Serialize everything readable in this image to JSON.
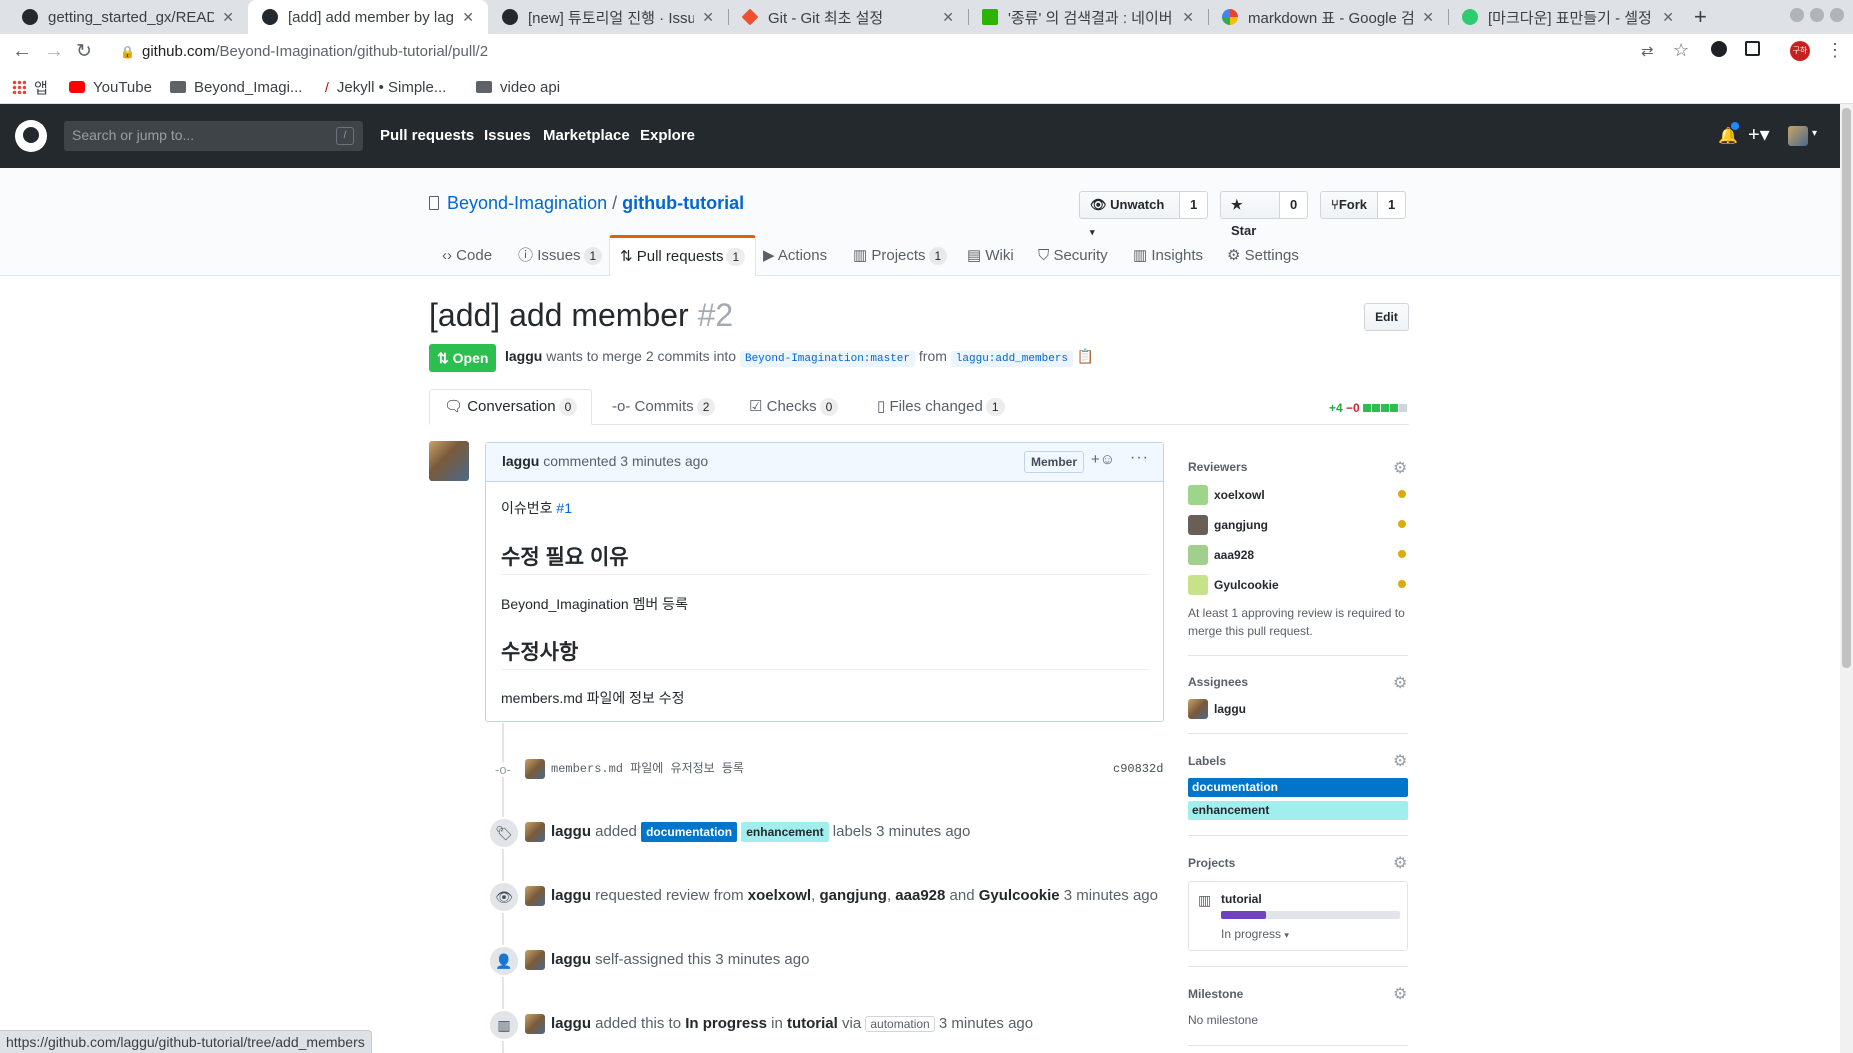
{
  "browser": {
    "tabs": [
      {
        "title": "getting_started_gx/READ",
        "icon": "github-icon",
        "active": false
      },
      {
        "title": "[add] add member by lagg",
        "icon": "github-icon",
        "active": true
      },
      {
        "title": "[new] 튜토리얼 진행 · Issue",
        "icon": "github-icon",
        "active": false
      },
      {
        "title": "Git - Git 최초 설정",
        "icon": "git-icon",
        "active": false
      },
      {
        "title": "'종류' 의 검색결과 : 네이버",
        "icon": "naver-icon",
        "active": false
      },
      {
        "title": "markdown 표 - Google 검",
        "icon": "google-icon",
        "active": false
      },
      {
        "title": "[마크다운] 표만들기 - 셀정",
        "icon": "site-icon",
        "active": false
      }
    ],
    "url_host": "github.com",
    "url_path": "/Beyond-Imagination/github-tutorial/pull/2",
    "bookmarks": [
      {
        "label": "앱",
        "icon": "apps-grid-icon"
      },
      {
        "label": "YouTube",
        "icon": "youtube-icon"
      },
      {
        "label": "Beyond_Imagi...",
        "icon": "folder-icon"
      },
      {
        "label": "Jekyll • Simple...",
        "icon": "jekyll-icon"
      },
      {
        "label": "video api",
        "icon": "folder-icon"
      }
    ],
    "profile_badge": "구하",
    "status_url": "https://github.com/laggu/github-tutorial/tree/add_members"
  },
  "header": {
    "search_placeholder": "Search or jump to...",
    "slash_key": "/",
    "nav": [
      "Pull requests",
      "Issues",
      "Marketplace",
      "Explore"
    ]
  },
  "repo": {
    "owner": "Beyond-Imagination",
    "separator": "/",
    "name": "github-tutorial",
    "unwatch_label": "Unwatch",
    "unwatch_count": "1",
    "star_label": "Star",
    "star_count": "0",
    "fork_label": "Fork",
    "fork_count": "1",
    "tabs": [
      {
        "label": "Code",
        "count": ""
      },
      {
        "label": "Issues",
        "count": "1"
      },
      {
        "label": "Pull requests",
        "count": "1"
      },
      {
        "label": "Actions",
        "count": ""
      },
      {
        "label": "Projects",
        "count": "1"
      },
      {
        "label": "Wiki",
        "count": ""
      },
      {
        "label": "Security",
        "count": ""
      },
      {
        "label": "Insights",
        "count": ""
      },
      {
        "label": "Settings",
        "count": ""
      }
    ]
  },
  "pr": {
    "title": "[add] add member",
    "number": "#2",
    "edit_label": "Edit",
    "state": "Open",
    "author": "laggu",
    "merge_text": "wants to merge 2 commits into",
    "base_branch": "Beyond-Imagination:master",
    "from_text": "from",
    "head_branch": "laggu:add_members",
    "tabs": [
      {
        "label": "Conversation",
        "count": "0"
      },
      {
        "label": "Commits",
        "count": "2"
      },
      {
        "label": "Checks",
        "count": "0"
      },
      {
        "label": "Files changed",
        "count": "1"
      }
    ],
    "diff_add": "+4",
    "diff_del": "−0"
  },
  "comment": {
    "author": "laggu",
    "meta": "commented 3 minutes ago",
    "role": "Member",
    "issue_prefix": "이슈번호",
    "issue_ref": "#1",
    "h1": "수정 필요 이유",
    "p1": "Beyond_Imagination 멤버 등록",
    "h2": "수정사항",
    "p2": "members.md 파일에 정보 수정"
  },
  "timeline": {
    "commit_msg": "members.md 파일에 유저정보 등록",
    "commit_sha": "c90832d",
    "labels_event": {
      "user": "laggu",
      "verb": "added",
      "label1": "documentation",
      "label2": "enhancement",
      "suffix": "labels 3 minutes ago"
    },
    "review_event": {
      "user": "laggu",
      "verb": "requested review from",
      "r1": "xoelxowl",
      "sep1": ",",
      "r2": "gangjung",
      "sep2": ",",
      "r3": "aaa928",
      "and": "and",
      "r4": "Gyulcookie",
      "time": "3 minutes ago"
    },
    "assign_event": {
      "user": "laggu",
      "text": "self-assigned this 3 minutes ago"
    },
    "project_event": {
      "user": "laggu",
      "verb": "added this to",
      "column": "In progress",
      "in": "in",
      "project": "tutorial",
      "via": "via",
      "automation": "automation",
      "time": "3 minutes ago"
    }
  },
  "sidebar": {
    "reviewers_title": "Reviewers",
    "reviewers": [
      "xoelxowl",
      "gangjung",
      "aaa928",
      "Gyulcookie"
    ],
    "reviewers_note": "At least 1 approving review is required to merge this pull request.",
    "assignees_title": "Assignees",
    "assignee": "laggu",
    "labels_title": "Labels",
    "labels": [
      {
        "name": "documentation",
        "color": "#0075ca",
        "text_color": "#ffffff"
      },
      {
        "name": "enhancement",
        "color": "#a2eeef",
        "text_color": "#24292e"
      }
    ],
    "projects_title": "Projects",
    "project_name": "tutorial",
    "project_progress": 0.25,
    "project_status": "In progress",
    "milestone_title": "Milestone",
    "milestone_value": "No milestone"
  }
}
